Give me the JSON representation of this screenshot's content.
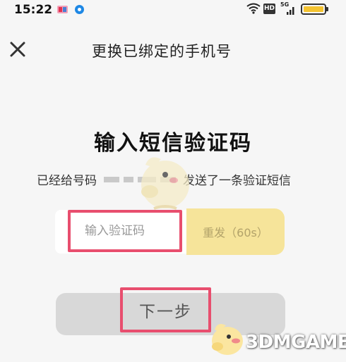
{
  "status_bar": {
    "time": "15:22",
    "hd_label": "HD",
    "network_label": "5G",
    "battery_level": 1.0,
    "battery_color": "#f4c330"
  },
  "header": {
    "title": "更换已绑定的手机号",
    "close_icon": "close-icon"
  },
  "main": {
    "title": "输入短信验证码",
    "sms_prefix": "已经给号码",
    "sms_suffix": "发送了一条验证短信",
    "code_placeholder": "输入验证码",
    "code_value": "",
    "resend_label": "重发（60s）",
    "next_label": "下一步"
  },
  "watermark": {
    "text": "3DMGAME"
  },
  "colors": {
    "highlight": "#e84e6e",
    "resend_bg": "#f6e49a",
    "next_bg": "#d8d8d8",
    "page_bg": "#f6f6f6"
  }
}
